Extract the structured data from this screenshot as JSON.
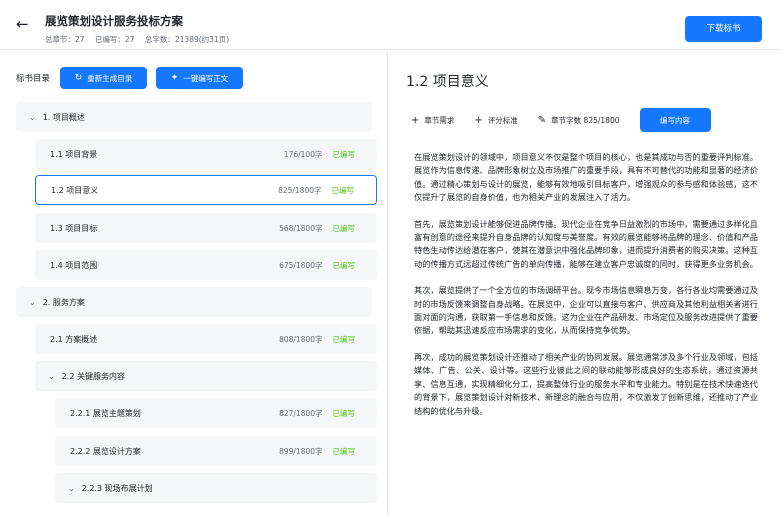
{
  "header": {
    "back_icon": "arrow-left-icon",
    "title": "展览策划设计服务投标方案",
    "stats": {
      "chapters": "总章节：27",
      "written": "已编写：27",
      "words": "总字数：21389(约31页)"
    },
    "download_label": "下载标书"
  },
  "toc": {
    "label": "标书目录",
    "regen_label": "重新生成目录",
    "regen_icon": "refresh-icon",
    "write_all_label": "一键编写正文",
    "write_all_icon": "magic-wand-icon",
    "items": [
      {
        "type": "group",
        "title": "1. 项目概述"
      },
      {
        "type": "item",
        "title": "1.1 项目背景",
        "count": "176/100字",
        "status": "已编写"
      },
      {
        "type": "item",
        "title": "1.2 项目意义",
        "count": "825/1800字",
        "status": "已编写",
        "active": true
      },
      {
        "type": "item",
        "title": "1.3 项目目标",
        "count": "568/1800字",
        "status": "已编写"
      },
      {
        "type": "item",
        "title": "1.4 项目范围",
        "count": "675/1800字",
        "status": "已编写"
      },
      {
        "type": "group",
        "title": "2. 服务方案"
      },
      {
        "type": "item",
        "title": "2.1 方案概述",
        "count": "808/1800字",
        "status": "已编写"
      },
      {
        "type": "subgroup",
        "title": "2.2 关键服务内容"
      },
      {
        "type": "subitem",
        "title": "2.2.1 展览主题策划",
        "count": "827/1800字",
        "status": "已编写"
      },
      {
        "type": "subitem",
        "title": "2.2.2 展览设计方案",
        "count": "899/1800字",
        "status": "已编写"
      },
      {
        "type": "subgroup2",
        "title": "2.2.3 现场布展计划"
      }
    ]
  },
  "section": {
    "title": "1.2 项目意义",
    "tools": {
      "requirements": "章节需求",
      "criteria": "评分标准",
      "word_count": "章节字数 825/1800"
    },
    "write_label": "编写内容",
    "paragraphs": [
      "在展览策划设计的领域中，项目意义不仅是整个项目的核心，也是其成功与否的重要评判标准。展览作为信息传递、品牌形象树立及市场推广的重要手段，具有不可替代的功能和显著的经济价值。通过精心策划与设计的展览，能够有效地吸引目标客户，增强观众的参与感和体验感，这不仅提升了展览的自身价值，也为相关产业的发展注入了活力。",
      "首先，展览策划设计能够促进品牌传播。现代企业在竞争日益激烈的市场中，需要通过多样化且富有创意的途径来提升自身品牌的认知度与美誉度。有效的展览能够将品牌的理念、价值和产品特色生动传达给潜在客户，使其在潜意识中强化品牌印象，进而提升消费者的购买决策。这种互动的传播方式远超过传统广告的单向传播，能够在建立客户忠诚度的同时，获得更多业务机会。",
      "其次，展览提供了一个全方位的市场调研平台。现今市场信息瞬息万变，各行各业均需要通过及时的市场反馈来调整自身战略。在展览中，企业可以直接与客户、供应商及其他利益相关者进行面对面的沟通，获取第一手信息和反馈。这为企业在产品研发、市场定位及服务改进提供了重要依据，帮助其迅速反应市场需求的变化，从而保持竞争优势。",
      "再次，成功的展览策划设计还推动了相关产业的协同发展。展览通常涉及多个行业及领域，包括媒体、广告、公关、设计等。这些行业彼此之间的联动能够形成良好的生态系统，通过资源共享、信息互通，实现精细化分工，提高整体行业的服务水平和专业能力。特别是在技术快速迭代的背景下，展览策划设计对新技术、新理念的融合与应用，不仅激发了创新思维，还推动了产业结构的优化与升级。"
    ]
  }
}
